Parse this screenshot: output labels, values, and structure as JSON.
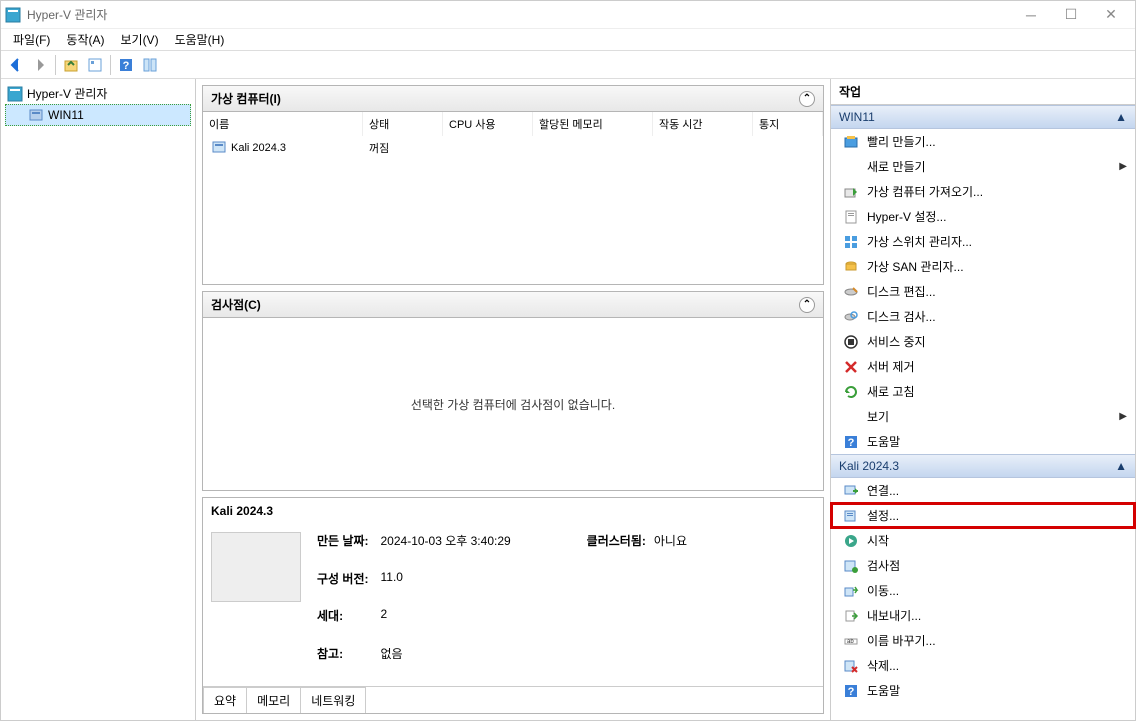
{
  "window": {
    "title": "Hyper-V 관리자"
  },
  "menu": {
    "file": "파일(F)",
    "action": "동작(A)",
    "view": "보기(V)",
    "help": "도움말(H)"
  },
  "tree": {
    "root": "Hyper-V 관리자",
    "node": "WIN11"
  },
  "vm_panel": {
    "title": "가상 컴퓨터(I)",
    "columns": {
      "name": "이름",
      "state": "상태",
      "cpu": "CPU 사용",
      "memory": "할당된 메모리",
      "uptime": "작동 시간",
      "status": "통지"
    },
    "rows": [
      {
        "name": "Kali 2024.3",
        "state": "꺼짐",
        "cpu": "",
        "memory": "",
        "uptime": "",
        "status": ""
      }
    ]
  },
  "checkpoint_panel": {
    "title": "검사점(C)",
    "message": "선택한 가상 컴퓨터에 검사점이 없습니다."
  },
  "summary_panel": {
    "title": "Kali 2024.3",
    "props": {
      "created_label": "만든 날짜:",
      "created_value": "2024-10-03 오후 3:40:29",
      "config_label": "구성 버전:",
      "config_value": "11.0",
      "gen_label": "세대:",
      "gen_value": "2",
      "notes_label": "참고:",
      "notes_value": "없음",
      "clustered_label": "클러스터됨:",
      "clustered_value": "아니요"
    },
    "tabs": {
      "summary": "요약",
      "memory": "메모리",
      "networking": "네트워킹"
    }
  },
  "actions": {
    "title": "작업",
    "section1": {
      "header": "WIN11",
      "items": {
        "quick_create": "빨리 만들기...",
        "new": "새로 만들기",
        "import": "가상 컴퓨터 가져오기...",
        "settings": "Hyper-V 설정...",
        "vswitch": "가상 스위치 관리자...",
        "vsan": "가상 SAN 관리자...",
        "edit_disk": "디스크 편집...",
        "inspect_disk": "디스크 검사...",
        "stop_service": "서비스 중지",
        "remove_server": "서버 제거",
        "refresh": "새로 고침",
        "view": "보기",
        "help": "도움말"
      }
    },
    "section2": {
      "header": "Kali 2024.3",
      "items": {
        "connect": "연결...",
        "settings": "설정...",
        "start": "시작",
        "checkpoint": "검사점",
        "move": "이동...",
        "export": "내보내기...",
        "rename": "이름 바꾸기...",
        "delete": "삭제...",
        "help": "도움말"
      }
    }
  }
}
